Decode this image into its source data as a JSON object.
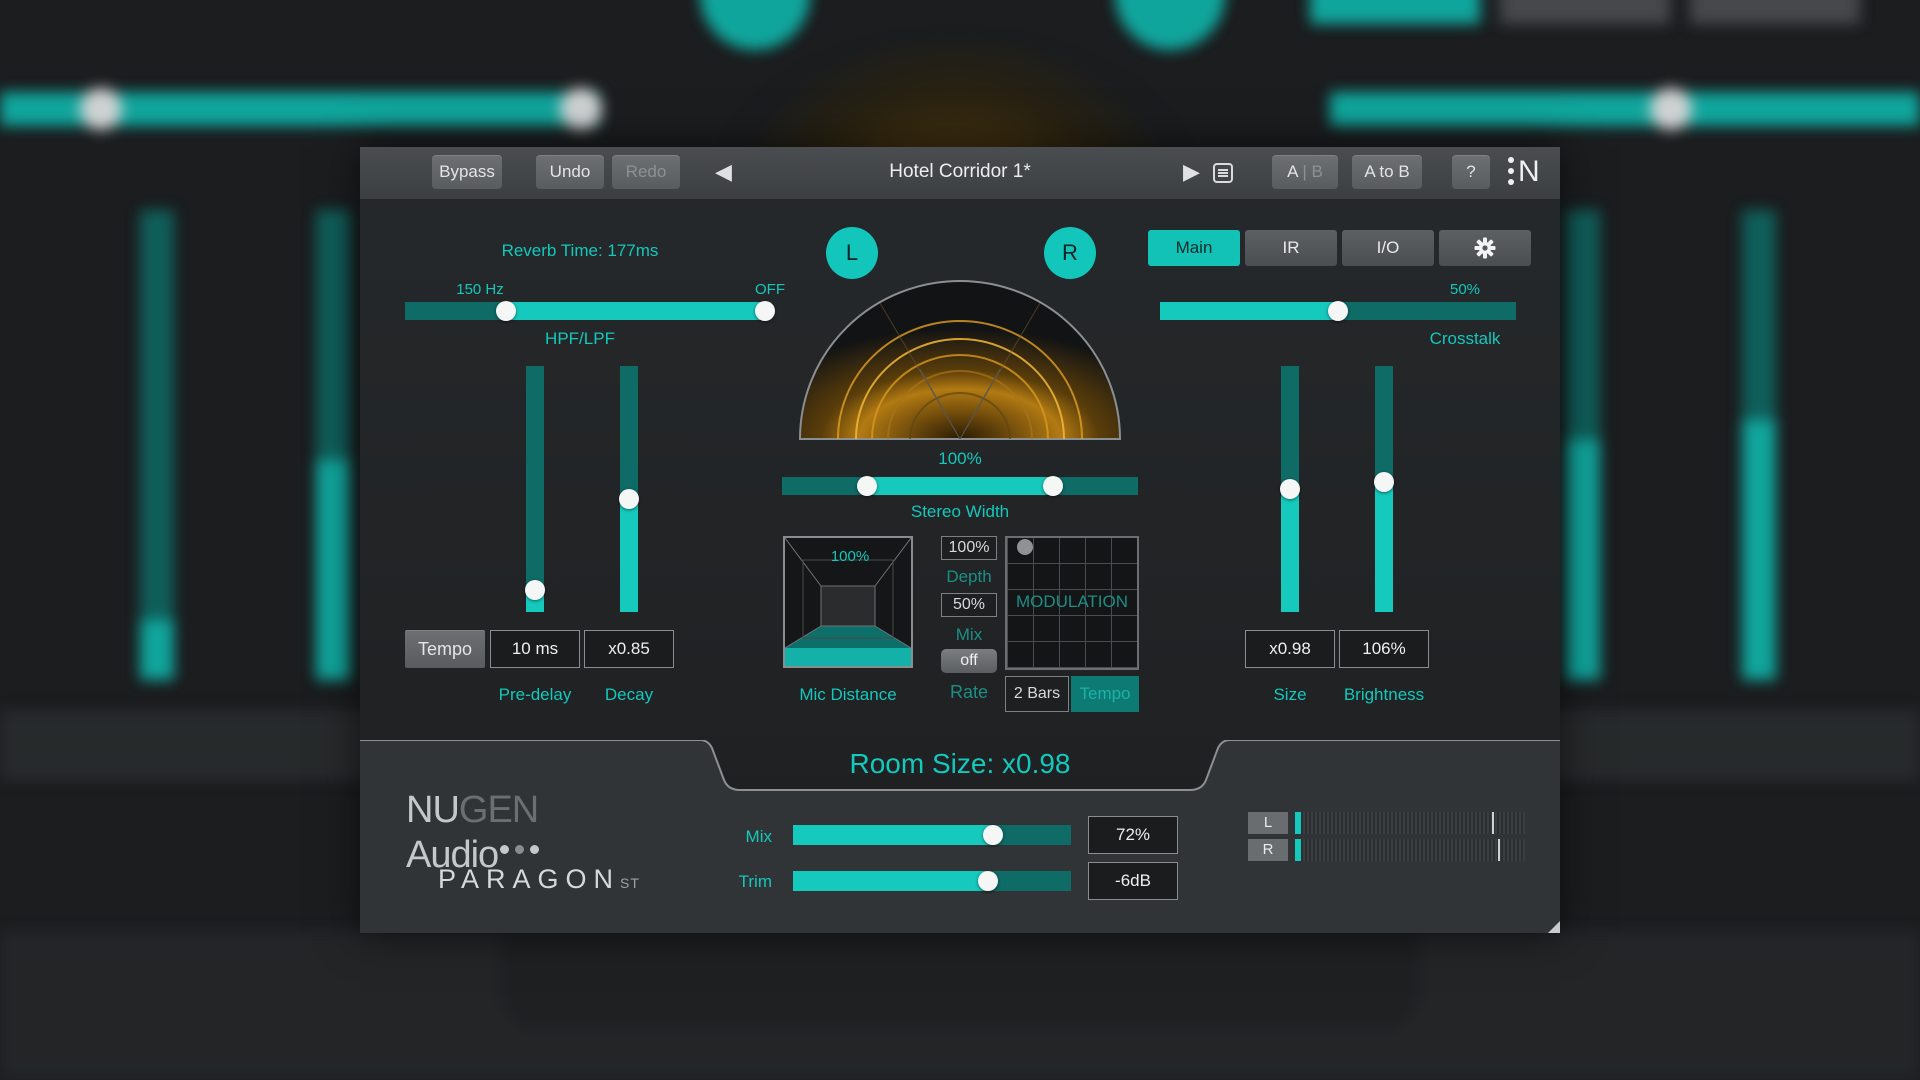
{
  "colors": {
    "accent": "#16c9bd",
    "accent_dark": "#0e6b66",
    "panel": "#202224",
    "toolbar": "#424548"
  },
  "toolbar": {
    "bypass": "Bypass",
    "undo": "Undo",
    "redo": "Redo",
    "preset_prev_icon": "triangle-left-icon",
    "preset_name": "Hotel Corridor 1*",
    "preset_next_icon": "triangle-right-icon",
    "preset_list_icon": "list-icon",
    "ab_a": "A",
    "ab_sep": "|",
    "ab_b": "B",
    "a_to_b": "A to B",
    "help": "?",
    "logo": "N"
  },
  "left": {
    "reverb_time": "Reverb Time: 177ms",
    "hpf_value": "150 Hz",
    "lpf_value": "OFF",
    "hpf_lpf_label": "HPF/LPF",
    "hpf_fraction": 0.28,
    "lpf_fraction": 1.0,
    "tempo_button": "Tempo",
    "predelay_value": "10 ms",
    "predelay_fraction": 0.09,
    "predelay_label": "Pre-delay",
    "decay_value": "x0.85",
    "decay_fraction": 0.46,
    "decay_label": "Decay"
  },
  "center": {
    "left_channel": "L",
    "right_channel": "R",
    "width_value": "100%",
    "width_label": "Stereo Width",
    "width_range": [
      0.24,
      0.76
    ],
    "mic_distance_value": "100%",
    "mic_distance_label": "Mic Distance",
    "depth_value": "100%",
    "depth_label": "Depth",
    "mix_value": "50%",
    "mix_label": "Mix",
    "rate_off": "off",
    "rate_label": "Rate",
    "modulation_label": "MODULATION",
    "rate_bars": "2 Bars",
    "tempo_button": "Tempo"
  },
  "right": {
    "tabs": [
      "Main",
      "IR",
      "I/O"
    ],
    "active_tab": "Main",
    "settings_icon": "gear-icon",
    "crosstalk_value": "50%",
    "crosstalk_label": "Crosstalk",
    "crosstalk_fraction": 0.5,
    "size_value": "x0.98",
    "size_fraction": 0.5,
    "size_label": "Size",
    "brightness_value": "106%",
    "brightness_fraction": 0.53,
    "brightness_label": "Brightness"
  },
  "bottom": {
    "room_size": "Room Size: x0.98",
    "brand_nu": "NU",
    "brand_gen": "GEN",
    "brand_audio": " Audio",
    "product": "PARAGON",
    "product_suffix": "ST",
    "mix_label": "Mix",
    "mix_value": "72%",
    "mix_fraction": 0.72,
    "trim_label": "Trim",
    "trim_value": "-6dB",
    "trim_fraction": 0.7,
    "meter_l": "L",
    "meter_r": "R"
  }
}
